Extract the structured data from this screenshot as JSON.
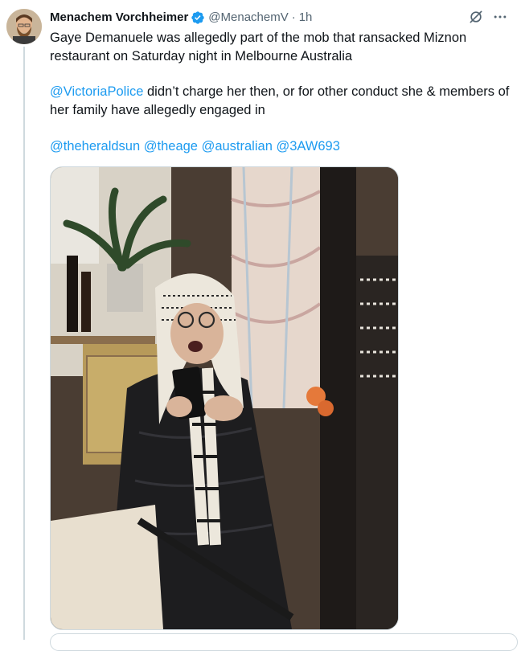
{
  "tweet": {
    "author_name": "Menachem Vorchheimer",
    "author_handle": "@MenachemV",
    "separator": "·",
    "time": "1h",
    "text_line1": "Gaye Demanuele was allegedly part of the mob that ransacked Miznon restaurant on Saturday night in Melbourne Australia",
    "mention_police": "@VictoriaPolice",
    "text_line2": " didn’t charge her then, or for other conduct she & members of her family have allegedly engaged in",
    "mention_heraldsun": "@theheraldsun",
    "mention_theage": "@theage",
    "mention_australian": "@australian",
    "mention_3aw": "@3AW693"
  },
  "icons": {
    "verified": "verified-badge-icon",
    "grok": "grok-icon",
    "more": "more-icon"
  },
  "colors": {
    "link": "#1d9bf0",
    "text": "#0f1419",
    "muted": "#536471",
    "verified": "#1d9bf0"
  }
}
